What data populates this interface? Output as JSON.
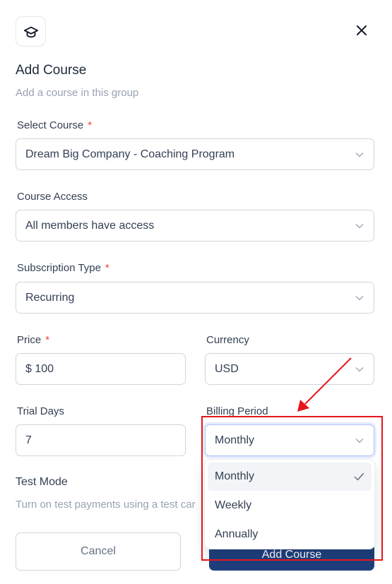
{
  "header": {
    "title": "Add Course",
    "subtitle": "Add a course in this group"
  },
  "form": {
    "select_course": {
      "label": "Select Course",
      "required": "*",
      "value": "Dream Big Company - Coaching Program"
    },
    "course_access": {
      "label": "Course Access",
      "value": "All members have access"
    },
    "subscription_type": {
      "label": "Subscription Type",
      "required": "*",
      "value": "Recurring"
    },
    "price": {
      "label": "Price",
      "required": "*",
      "value": "$ 100"
    },
    "currency": {
      "label": "Currency",
      "value": "USD"
    },
    "trial_days": {
      "label": "Trial Days",
      "value": "7"
    },
    "billing_period": {
      "label": "Billing Period",
      "value": "Monthly"
    },
    "test_mode": {
      "label": "Test Mode",
      "description": "Turn on test payments using a test car"
    }
  },
  "billing_dropdown": {
    "options": [
      "Monthly",
      "Weekly",
      "Annually"
    ],
    "selected": "Monthly"
  },
  "buttons": {
    "cancel": "Cancel",
    "add": "Add Course"
  },
  "annotation": {
    "color": "#e5161b"
  }
}
